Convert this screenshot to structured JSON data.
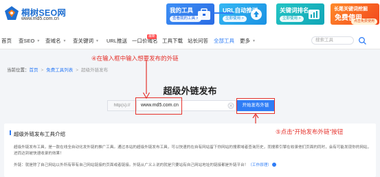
{
  "brand": {
    "name": "桐树SEO网",
    "url": "www.md5.com.cn"
  },
  "promos": [
    {
      "title": "我的工具",
      "button": "查看我的工具 >"
    },
    {
      "title": "URL自动推送",
      "button": "立即使用 >"
    },
    {
      "title": "关键词排名",
      "button": "立即使用 >"
    }
  ],
  "promo_ad": {
    "line1": "长尾关键词挖掘",
    "line2": "免费使用",
    "button": "点击免费使用"
  },
  "nav": {
    "items": [
      "首页",
      "查SEO",
      "查域名",
      "查关键词",
      "URL推送",
      "一口价域名",
      "工具下载",
      "站长问答",
      "全部工具",
      "更多"
    ],
    "badge": "最新",
    "search_placeholder": "搜索工具"
  },
  "annotations": {
    "step4": "④在输入框中输入想要发布的外链",
    "step5": "⑤点击“开始发布外链”按钮"
  },
  "breadcrumb": {
    "label": "当前位置：",
    "home": "首页",
    "list": "免费工具列表",
    "current": "超级外链发布"
  },
  "page_title": "超级外链发布",
  "form": {
    "prefix": "http(s)://",
    "value": "www.md5.com.cn",
    "submit": "开始发布外链"
  },
  "intro": {
    "title": "超级外链发布工具介绍",
    "p1": "超级外链发布工具，是一款在线全自动化发外链的推广工具。通过本站的超级外链发布工具，可以快速的在自有网站留下你网站的搜索域者查询历史，而搜索引擎在收录他们页面的同时，会有可能发现你的网站，进而达到被快速收录的效果！",
    "p2": "外链：就是除了自己网站以外所有带有自己网站链接的页面或者链接。外链从广义上说的就是只要站有自己网站地址的链接都是外链平台！",
    "link": "（工作原理）"
  },
  "colors": {
    "primary": "#2f7df6",
    "annotation": "#e5312b"
  }
}
